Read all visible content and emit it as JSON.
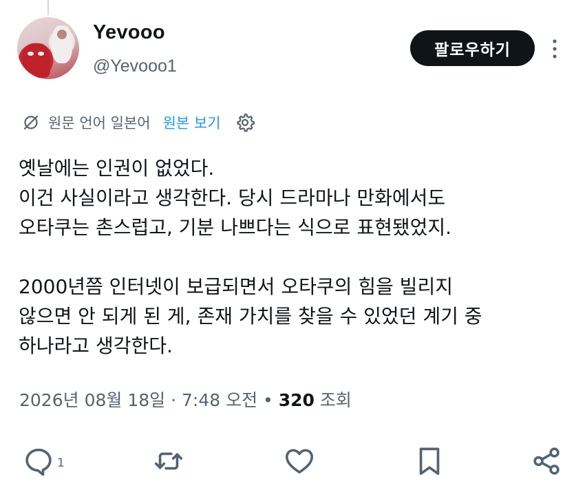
{
  "user": {
    "display_name": "Yevooo",
    "handle": "@Yevooo1",
    "follow_label": "팔로우하기"
  },
  "translation": {
    "icon": "translate-slash-icon",
    "note": "원문 언어 일본어",
    "view_original": "원본 보기",
    "settings_icon": "gear-icon"
  },
  "tweet": {
    "lines": [
      "옛날에는 인권이 없었다.",
      "이건 사실이라고 생각한다. 당시 드라마나 만화에서도",
      "오타쿠는 촌스럽고, 기분 나쁘다는 식으로 표현됐었지.",
      "",
      "2000년쯤 인터넷이 보급되면서 오타쿠의 힘을 빌리지",
      "않으면 안 되게 된 게, 존재 가치를 찾을 수 있었던 계기 중",
      "하나라고 생각한다."
    ]
  },
  "meta": {
    "date": "2026년 08월 18일",
    "separator1": " · ",
    "time": "7:48 오전",
    "separator2": " • ",
    "views_count": "320",
    "views_label": " 조회"
  },
  "actions": {
    "reply_count": "1",
    "icons": [
      "reply-icon",
      "retweet-icon",
      "like-icon",
      "bookmark-icon",
      "share-icon"
    ]
  }
}
